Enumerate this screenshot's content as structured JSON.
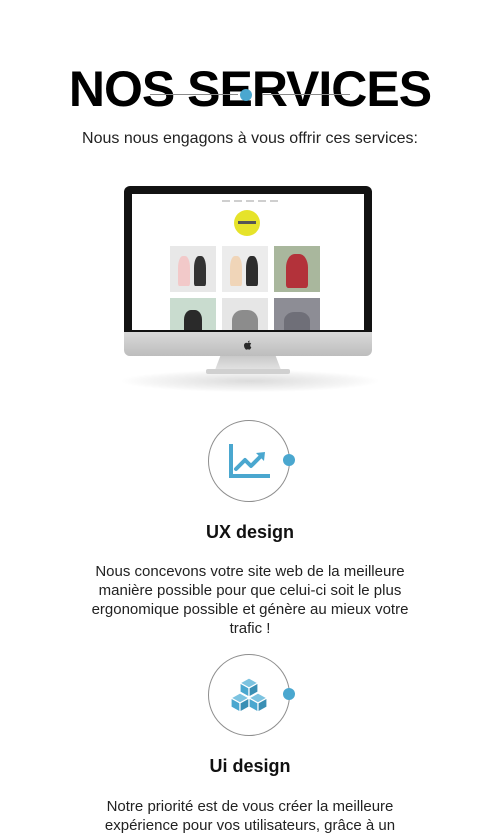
{
  "header": {
    "title": "NOS SERVICES",
    "intro": "Nous nous engagons à vous offrir ces services:"
  },
  "colors": {
    "accent": "#4aa7cf",
    "divider": "#8a8a8a",
    "text": "#222222"
  },
  "hero_image": {
    "icon": "imac-mockup-icon",
    "apple_logo": "apple-logo-icon"
  },
  "services": [
    {
      "icon": "chart-growth-icon",
      "title": "UX design",
      "description": "Nous concevons votre site web de la meilleure manière possible pour que celui-ci soit le plus ergonomique possible et génère au mieux votre trafic !"
    },
    {
      "icon": "cubes-icon",
      "title": "Ui design",
      "description": "Notre priorité est de vous créer la meilleure expérience pour vos utilisateurs, grâce à un"
    }
  ]
}
